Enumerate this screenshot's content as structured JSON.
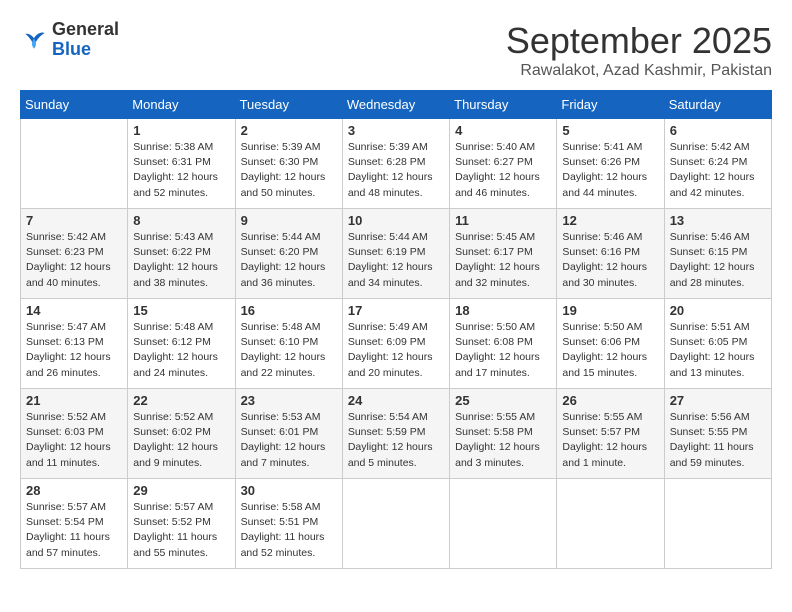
{
  "logo": {
    "general": "General",
    "blue": "Blue"
  },
  "title": "September 2025",
  "location": "Rawalakot, Azad Kashmir, Pakistan",
  "headers": [
    "Sunday",
    "Monday",
    "Tuesday",
    "Wednesday",
    "Thursday",
    "Friday",
    "Saturday"
  ],
  "weeks": [
    [
      {
        "day": "",
        "info": ""
      },
      {
        "day": "1",
        "info": "Sunrise: 5:38 AM\nSunset: 6:31 PM\nDaylight: 12 hours\nand 52 minutes."
      },
      {
        "day": "2",
        "info": "Sunrise: 5:39 AM\nSunset: 6:30 PM\nDaylight: 12 hours\nand 50 minutes."
      },
      {
        "day": "3",
        "info": "Sunrise: 5:39 AM\nSunset: 6:28 PM\nDaylight: 12 hours\nand 48 minutes."
      },
      {
        "day": "4",
        "info": "Sunrise: 5:40 AM\nSunset: 6:27 PM\nDaylight: 12 hours\nand 46 minutes."
      },
      {
        "day": "5",
        "info": "Sunrise: 5:41 AM\nSunset: 6:26 PM\nDaylight: 12 hours\nand 44 minutes."
      },
      {
        "day": "6",
        "info": "Sunrise: 5:42 AM\nSunset: 6:24 PM\nDaylight: 12 hours\nand 42 minutes."
      }
    ],
    [
      {
        "day": "7",
        "info": "Sunrise: 5:42 AM\nSunset: 6:23 PM\nDaylight: 12 hours\nand 40 minutes."
      },
      {
        "day": "8",
        "info": "Sunrise: 5:43 AM\nSunset: 6:22 PM\nDaylight: 12 hours\nand 38 minutes."
      },
      {
        "day": "9",
        "info": "Sunrise: 5:44 AM\nSunset: 6:20 PM\nDaylight: 12 hours\nand 36 minutes."
      },
      {
        "day": "10",
        "info": "Sunrise: 5:44 AM\nSunset: 6:19 PM\nDaylight: 12 hours\nand 34 minutes."
      },
      {
        "day": "11",
        "info": "Sunrise: 5:45 AM\nSunset: 6:17 PM\nDaylight: 12 hours\nand 32 minutes."
      },
      {
        "day": "12",
        "info": "Sunrise: 5:46 AM\nSunset: 6:16 PM\nDaylight: 12 hours\nand 30 minutes."
      },
      {
        "day": "13",
        "info": "Sunrise: 5:46 AM\nSunset: 6:15 PM\nDaylight: 12 hours\nand 28 minutes."
      }
    ],
    [
      {
        "day": "14",
        "info": "Sunrise: 5:47 AM\nSunset: 6:13 PM\nDaylight: 12 hours\nand 26 minutes."
      },
      {
        "day": "15",
        "info": "Sunrise: 5:48 AM\nSunset: 6:12 PM\nDaylight: 12 hours\nand 24 minutes."
      },
      {
        "day": "16",
        "info": "Sunrise: 5:48 AM\nSunset: 6:10 PM\nDaylight: 12 hours\nand 22 minutes."
      },
      {
        "day": "17",
        "info": "Sunrise: 5:49 AM\nSunset: 6:09 PM\nDaylight: 12 hours\nand 20 minutes."
      },
      {
        "day": "18",
        "info": "Sunrise: 5:50 AM\nSunset: 6:08 PM\nDaylight: 12 hours\nand 17 minutes."
      },
      {
        "day": "19",
        "info": "Sunrise: 5:50 AM\nSunset: 6:06 PM\nDaylight: 12 hours\nand 15 minutes."
      },
      {
        "day": "20",
        "info": "Sunrise: 5:51 AM\nSunset: 6:05 PM\nDaylight: 12 hours\nand 13 minutes."
      }
    ],
    [
      {
        "day": "21",
        "info": "Sunrise: 5:52 AM\nSunset: 6:03 PM\nDaylight: 12 hours\nand 11 minutes."
      },
      {
        "day": "22",
        "info": "Sunrise: 5:52 AM\nSunset: 6:02 PM\nDaylight: 12 hours\nand 9 minutes."
      },
      {
        "day": "23",
        "info": "Sunrise: 5:53 AM\nSunset: 6:01 PM\nDaylight: 12 hours\nand 7 minutes."
      },
      {
        "day": "24",
        "info": "Sunrise: 5:54 AM\nSunset: 5:59 PM\nDaylight: 12 hours\nand 5 minutes."
      },
      {
        "day": "25",
        "info": "Sunrise: 5:55 AM\nSunset: 5:58 PM\nDaylight: 12 hours\nand 3 minutes."
      },
      {
        "day": "26",
        "info": "Sunrise: 5:55 AM\nSunset: 5:57 PM\nDaylight: 12 hours\nand 1 minute."
      },
      {
        "day": "27",
        "info": "Sunrise: 5:56 AM\nSunset: 5:55 PM\nDaylight: 11 hours\nand 59 minutes."
      }
    ],
    [
      {
        "day": "28",
        "info": "Sunrise: 5:57 AM\nSunset: 5:54 PM\nDaylight: 11 hours\nand 57 minutes."
      },
      {
        "day": "29",
        "info": "Sunrise: 5:57 AM\nSunset: 5:52 PM\nDaylight: 11 hours\nand 55 minutes."
      },
      {
        "day": "30",
        "info": "Sunrise: 5:58 AM\nSunset: 5:51 PM\nDaylight: 11 hours\nand 52 minutes."
      },
      {
        "day": "",
        "info": ""
      },
      {
        "day": "",
        "info": ""
      },
      {
        "day": "",
        "info": ""
      },
      {
        "day": "",
        "info": ""
      }
    ]
  ]
}
